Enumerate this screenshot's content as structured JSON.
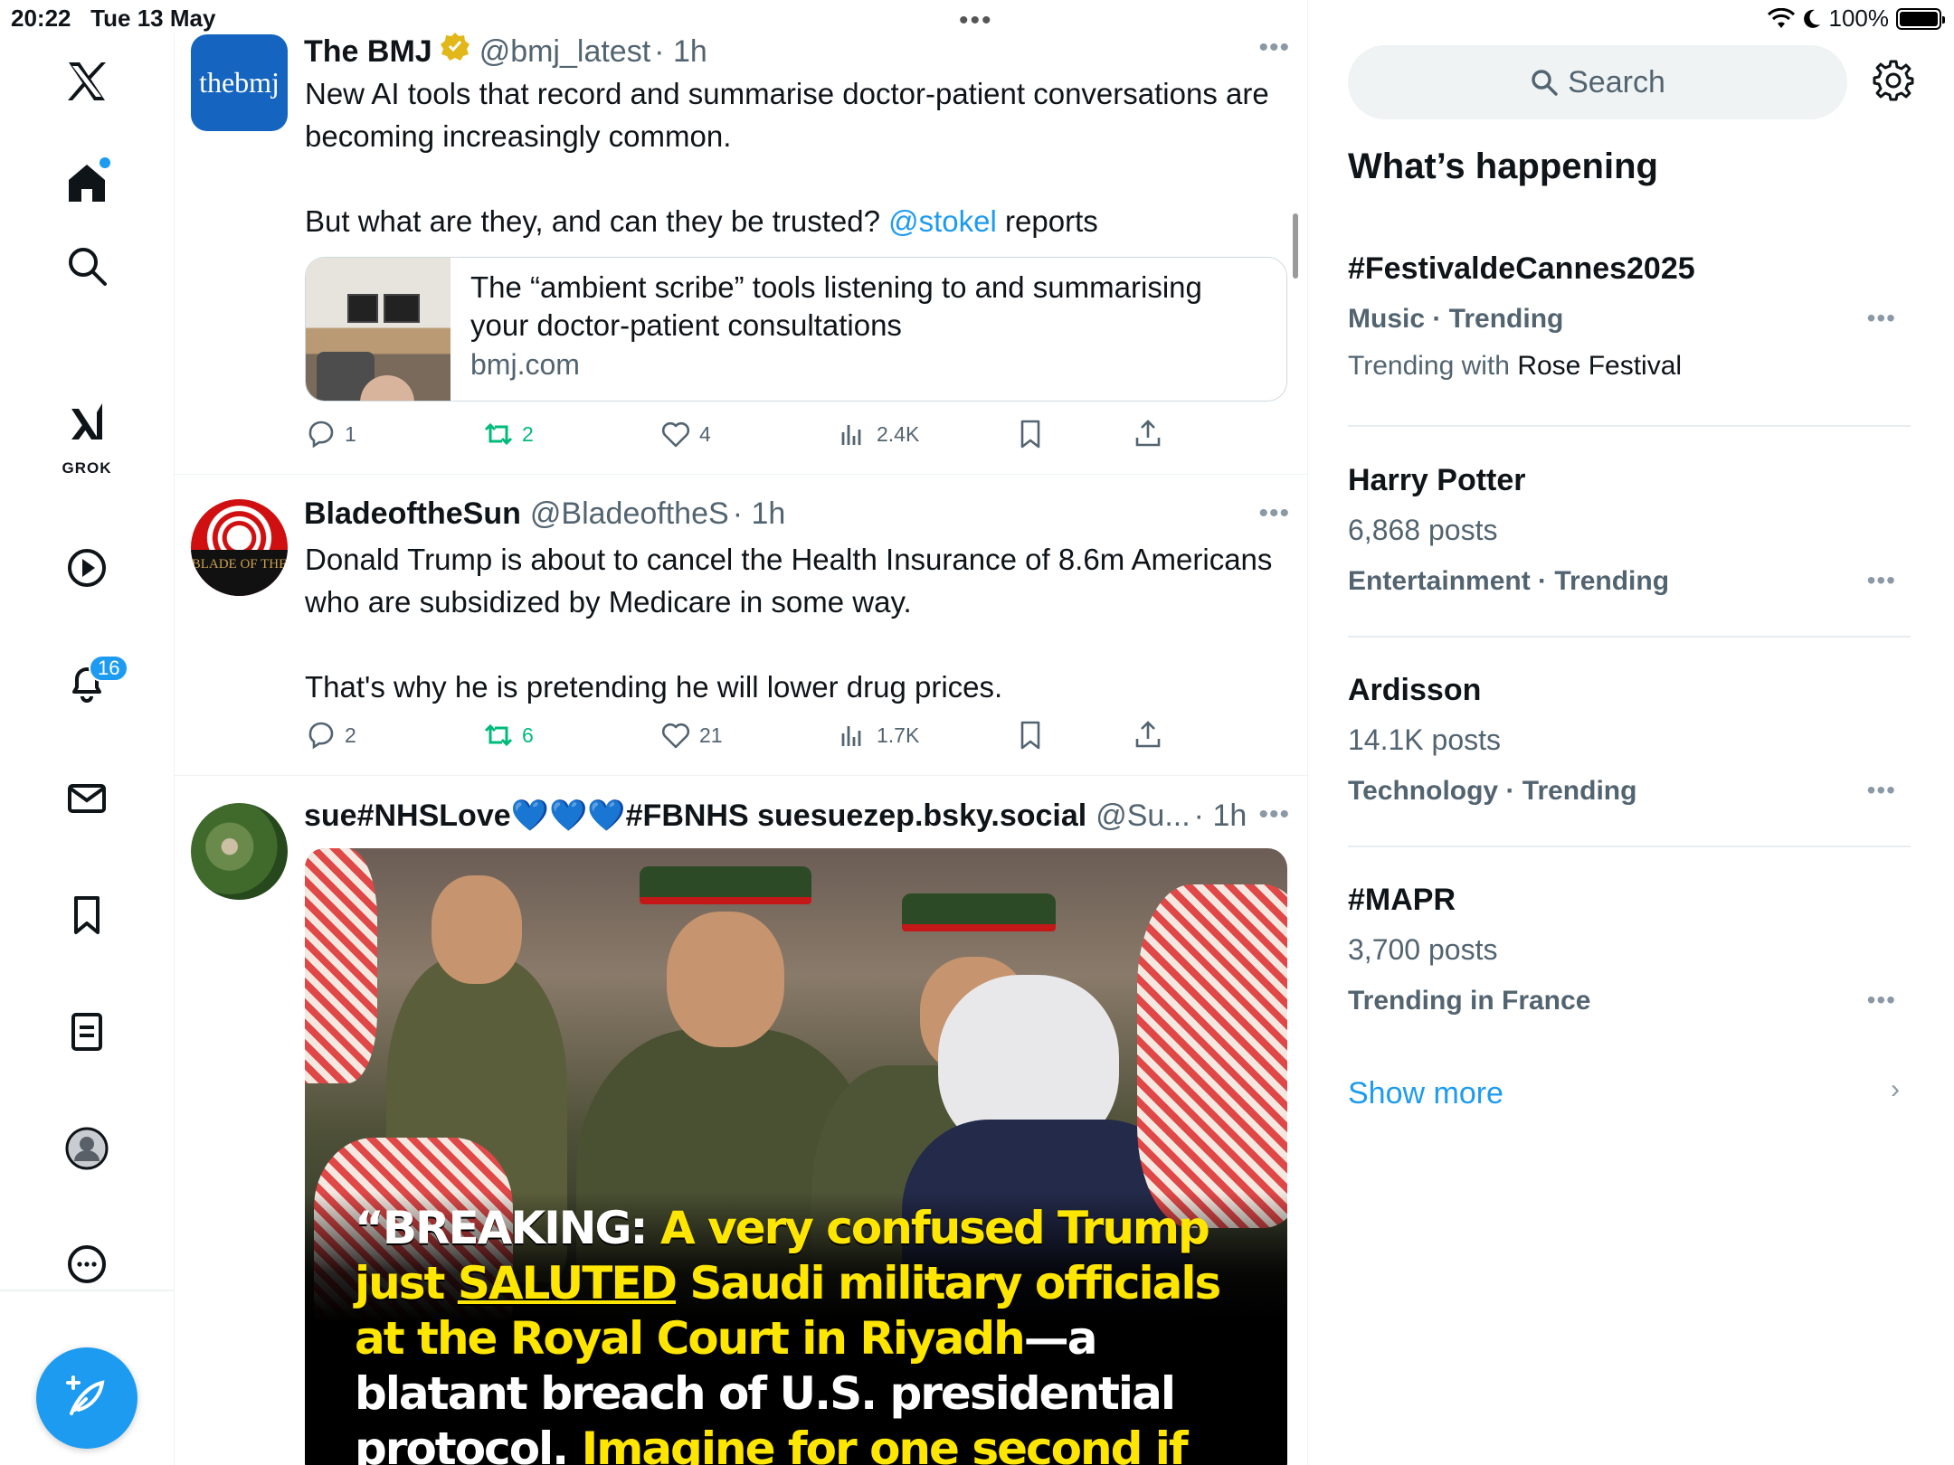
{
  "status_bar": {
    "time": "20:22",
    "date": "Tue 13 May",
    "battery": "100%"
  },
  "nav": {
    "grok_label": "GROK",
    "notifications_badge": "16",
    "accent": "#1d9bf0"
  },
  "feed": {
    "tweets": [
      {
        "name": "The BMJ",
        "handle": "@bmj_latest",
        "time": "· 1h",
        "avatar_logo_text": "thebmj",
        "text_para1": "New AI tools that record and summarise doctor-patient conversations are becoming increasingly common.",
        "text_para2_pre": "But what are they, and can they be trusted?",
        "text_para2_mention": "@stokel",
        "text_para2_post": "reports",
        "link_title": "The “ambient scribe” tools listening to and summarising your doctor-patient consultations",
        "link_domain": "bmj.com",
        "replies": "1",
        "retweets": "2",
        "likes": "4",
        "views": "2.4K"
      },
      {
        "name": "BladeoftheSun",
        "handle": "@BladeoftheS",
        "time": "· 1h",
        "avatar_text": "BLADE OF THE",
        "text_para1": "Donald Trump is about to cancel the Health Insurance of 8.6m Americans who are subsidized by Medicare in some way.",
        "text_para2": "That's why he is pretending he will lower drug prices.",
        "replies": "2",
        "retweets": "6",
        "likes": "21",
        "views": "1.7K"
      },
      {
        "name": "sue#NHSLove💙💙💙#FBNHS suesuezep.bsky.social",
        "handle": "@Su...",
        "time": "· 1h",
        "media_caption": {
          "quote_open": "“BREAKING:",
          "part1": "A very confused Trump just",
          "saluted": "SALUTED",
          "part2": "Saudi military officials at the Royal Court in Riyadh",
          "dash_part": "—a blatant breach of U.S. presidential protocol.",
          "part3": "Imagine for one second if"
        }
      }
    ]
  },
  "sidebar": {
    "search_placeholder": "Search",
    "whats_happening": "What’s happening",
    "trends": [
      {
        "name": "#FestivaldeCannes2025",
        "meta": "Music · Trending",
        "with_prefix": "Trending with",
        "with_value": "Rose Festival"
      },
      {
        "name": "Harry Potter",
        "count": "6,868 posts",
        "meta": "Entertainment · Trending"
      },
      {
        "name": "Ardisson",
        "count": "14.1K posts",
        "meta": "Technology · Trending"
      },
      {
        "name": "#MAPR",
        "count": "3,700 posts",
        "meta": "Trending in France"
      }
    ],
    "show_more": "Show more"
  }
}
